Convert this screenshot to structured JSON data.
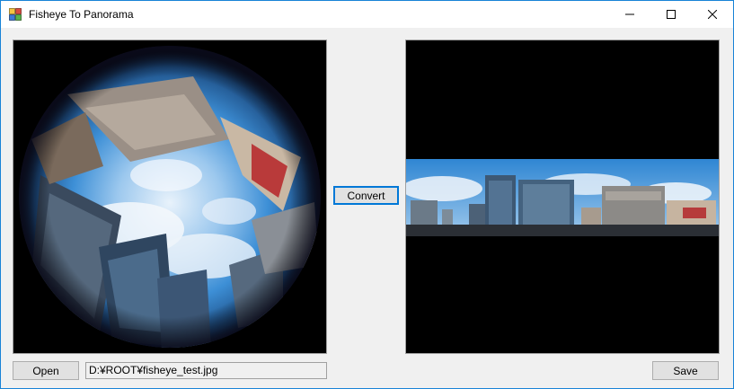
{
  "window": {
    "title": "Fisheye To Panorama",
    "controls": {
      "minimize": "minimize-icon",
      "maximize": "maximize-icon",
      "close": "close-icon"
    }
  },
  "panels": {
    "input": {
      "content": "fisheye image (circular sky/buildings view)"
    },
    "output": {
      "content": "panorama strip (city buildings under blue sky)"
    }
  },
  "buttons": {
    "convert": "Convert",
    "open": "Open",
    "save": "Save"
  },
  "file": {
    "path": "D:¥ROOT¥fisheye_test.jpg"
  },
  "colors": {
    "accent": "#0078d7",
    "window_border": "#1883d7",
    "panel_bg": "#000000",
    "form_bg": "#f0f0f0"
  }
}
